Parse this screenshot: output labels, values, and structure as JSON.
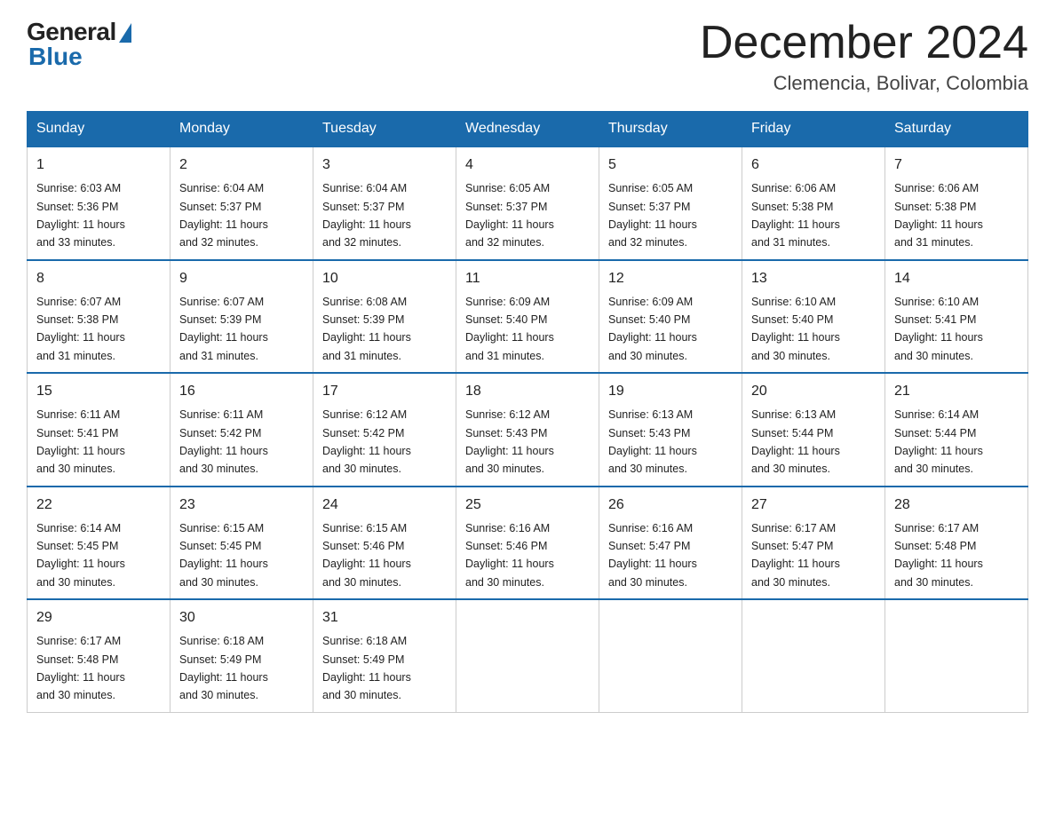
{
  "logo": {
    "general": "General",
    "blue": "Blue"
  },
  "title": {
    "month": "December 2024",
    "location": "Clemencia, Bolivar, Colombia"
  },
  "days_of_week": [
    "Sunday",
    "Monday",
    "Tuesday",
    "Wednesday",
    "Thursday",
    "Friday",
    "Saturday"
  ],
  "weeks": [
    [
      {
        "day": "1",
        "sunrise": "6:03 AM",
        "sunset": "5:36 PM",
        "daylight": "11 hours and 33 minutes."
      },
      {
        "day": "2",
        "sunrise": "6:04 AM",
        "sunset": "5:37 PM",
        "daylight": "11 hours and 32 minutes."
      },
      {
        "day": "3",
        "sunrise": "6:04 AM",
        "sunset": "5:37 PM",
        "daylight": "11 hours and 32 minutes."
      },
      {
        "day": "4",
        "sunrise": "6:05 AM",
        "sunset": "5:37 PM",
        "daylight": "11 hours and 32 minutes."
      },
      {
        "day": "5",
        "sunrise": "6:05 AM",
        "sunset": "5:37 PM",
        "daylight": "11 hours and 32 minutes."
      },
      {
        "day": "6",
        "sunrise": "6:06 AM",
        "sunset": "5:38 PM",
        "daylight": "11 hours and 31 minutes."
      },
      {
        "day": "7",
        "sunrise": "6:06 AM",
        "sunset": "5:38 PM",
        "daylight": "11 hours and 31 minutes."
      }
    ],
    [
      {
        "day": "8",
        "sunrise": "6:07 AM",
        "sunset": "5:38 PM",
        "daylight": "11 hours and 31 minutes."
      },
      {
        "day": "9",
        "sunrise": "6:07 AM",
        "sunset": "5:39 PM",
        "daylight": "11 hours and 31 minutes."
      },
      {
        "day": "10",
        "sunrise": "6:08 AM",
        "sunset": "5:39 PM",
        "daylight": "11 hours and 31 minutes."
      },
      {
        "day": "11",
        "sunrise": "6:09 AM",
        "sunset": "5:40 PM",
        "daylight": "11 hours and 31 minutes."
      },
      {
        "day": "12",
        "sunrise": "6:09 AM",
        "sunset": "5:40 PM",
        "daylight": "11 hours and 30 minutes."
      },
      {
        "day": "13",
        "sunrise": "6:10 AM",
        "sunset": "5:40 PM",
        "daylight": "11 hours and 30 minutes."
      },
      {
        "day": "14",
        "sunrise": "6:10 AM",
        "sunset": "5:41 PM",
        "daylight": "11 hours and 30 minutes."
      }
    ],
    [
      {
        "day": "15",
        "sunrise": "6:11 AM",
        "sunset": "5:41 PM",
        "daylight": "11 hours and 30 minutes."
      },
      {
        "day": "16",
        "sunrise": "6:11 AM",
        "sunset": "5:42 PM",
        "daylight": "11 hours and 30 minutes."
      },
      {
        "day": "17",
        "sunrise": "6:12 AM",
        "sunset": "5:42 PM",
        "daylight": "11 hours and 30 minutes."
      },
      {
        "day": "18",
        "sunrise": "6:12 AM",
        "sunset": "5:43 PM",
        "daylight": "11 hours and 30 minutes."
      },
      {
        "day": "19",
        "sunrise": "6:13 AM",
        "sunset": "5:43 PM",
        "daylight": "11 hours and 30 minutes."
      },
      {
        "day": "20",
        "sunrise": "6:13 AM",
        "sunset": "5:44 PM",
        "daylight": "11 hours and 30 minutes."
      },
      {
        "day": "21",
        "sunrise": "6:14 AM",
        "sunset": "5:44 PM",
        "daylight": "11 hours and 30 minutes."
      }
    ],
    [
      {
        "day": "22",
        "sunrise": "6:14 AM",
        "sunset": "5:45 PM",
        "daylight": "11 hours and 30 minutes."
      },
      {
        "day": "23",
        "sunrise": "6:15 AM",
        "sunset": "5:45 PM",
        "daylight": "11 hours and 30 minutes."
      },
      {
        "day": "24",
        "sunrise": "6:15 AM",
        "sunset": "5:46 PM",
        "daylight": "11 hours and 30 minutes."
      },
      {
        "day": "25",
        "sunrise": "6:16 AM",
        "sunset": "5:46 PM",
        "daylight": "11 hours and 30 minutes."
      },
      {
        "day": "26",
        "sunrise": "6:16 AM",
        "sunset": "5:47 PM",
        "daylight": "11 hours and 30 minutes."
      },
      {
        "day": "27",
        "sunrise": "6:17 AM",
        "sunset": "5:47 PM",
        "daylight": "11 hours and 30 minutes."
      },
      {
        "day": "28",
        "sunrise": "6:17 AM",
        "sunset": "5:48 PM",
        "daylight": "11 hours and 30 minutes."
      }
    ],
    [
      {
        "day": "29",
        "sunrise": "6:17 AM",
        "sunset": "5:48 PM",
        "daylight": "11 hours and 30 minutes."
      },
      {
        "day": "30",
        "sunrise": "6:18 AM",
        "sunset": "5:49 PM",
        "daylight": "11 hours and 30 minutes."
      },
      {
        "day": "31",
        "sunrise": "6:18 AM",
        "sunset": "5:49 PM",
        "daylight": "11 hours and 30 minutes."
      },
      null,
      null,
      null,
      null
    ]
  ],
  "labels": {
    "sunrise": "Sunrise: ",
    "sunset": "Sunset: ",
    "daylight": "Daylight: "
  }
}
